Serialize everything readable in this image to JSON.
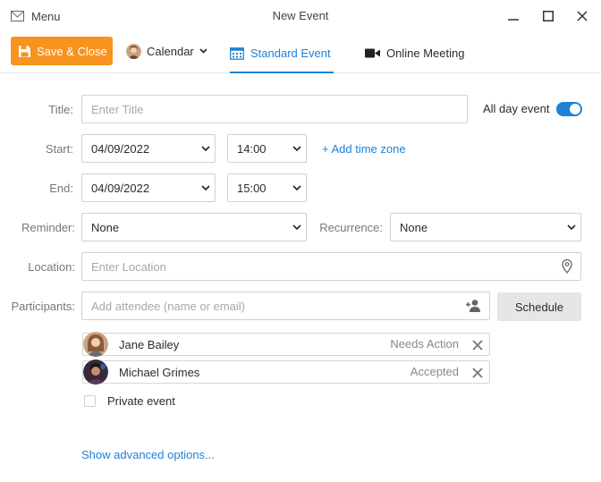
{
  "titlebar": {
    "menu_label": "Menu",
    "window_title": "New Event"
  },
  "toolbar": {
    "save_label": "Save & Close",
    "calendar_label": "Calendar",
    "tabs": [
      {
        "label": "Standard Event",
        "active": true,
        "icon": "calendar-icon"
      },
      {
        "label": "Online Meeting",
        "active": false,
        "icon": "video-camera-icon"
      }
    ]
  },
  "form": {
    "title": {
      "label": "Title:",
      "placeholder": "Enter Title",
      "value": ""
    },
    "all_day": {
      "label": "All day event",
      "on": true
    },
    "start": {
      "label": "Start:",
      "date": "04/09/2022",
      "time": "14:00"
    },
    "add_time_zone": "+ Add time zone",
    "end": {
      "label": "End:",
      "date": "04/09/2022",
      "time": "15:00"
    },
    "reminder": {
      "label": "Reminder:",
      "value": "None"
    },
    "recurrence": {
      "label": "Recurrence:",
      "value": "None"
    },
    "location": {
      "label": "Location:",
      "placeholder": "Enter Location"
    },
    "participants": {
      "label": "Participants:",
      "placeholder": "Add attendee (name or email)",
      "schedule_label": "Schedule"
    },
    "attendees": [
      {
        "name": "Jane Bailey",
        "status": "Needs Action"
      },
      {
        "name": "Michael Grimes",
        "status": "Accepted"
      }
    ],
    "private_event": {
      "label": "Private event",
      "checked": false
    },
    "advanced_link": "Show advanced options..."
  },
  "colors": {
    "accent": "#1e82d6",
    "save_button": "#f7931e"
  }
}
